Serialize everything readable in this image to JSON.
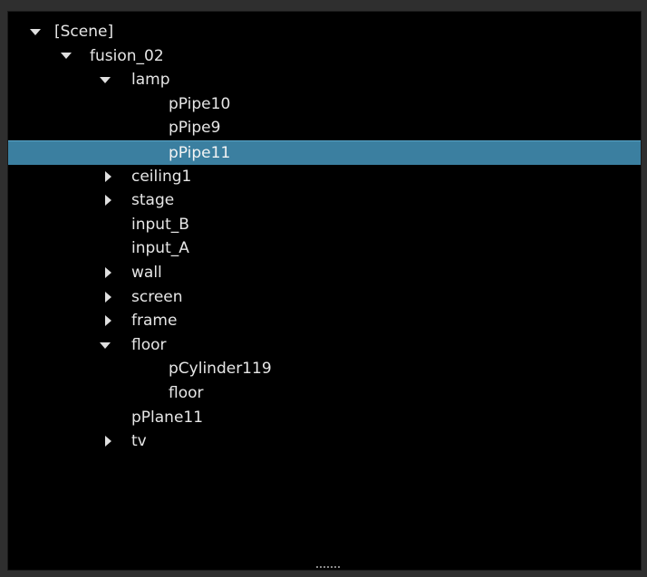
{
  "tree": {
    "scene": "[Scene]",
    "fusion_02": "fusion_02",
    "lamp": "lamp",
    "pPipe10": "pPipe10",
    "pPipe9": "pPipe9",
    "pPipe11": "pPipe11",
    "ceiling1": "ceiling1",
    "stage": "stage",
    "input_B": "input_B",
    "input_A": "input_A",
    "wall": "wall",
    "screen": "screen",
    "frame": "frame",
    "floor": "floor",
    "pCylinder119": "pCylinder119",
    "floor_child": "floor",
    "pPlane11": "pPlane11",
    "tv": "tv"
  },
  "colors": {
    "selection": "#3b7fa0",
    "background": "#000000",
    "text": "#e6e6e6"
  },
  "icons": {
    "expanded": "triangle-down-icon",
    "collapsed": "triangle-right-icon"
  }
}
